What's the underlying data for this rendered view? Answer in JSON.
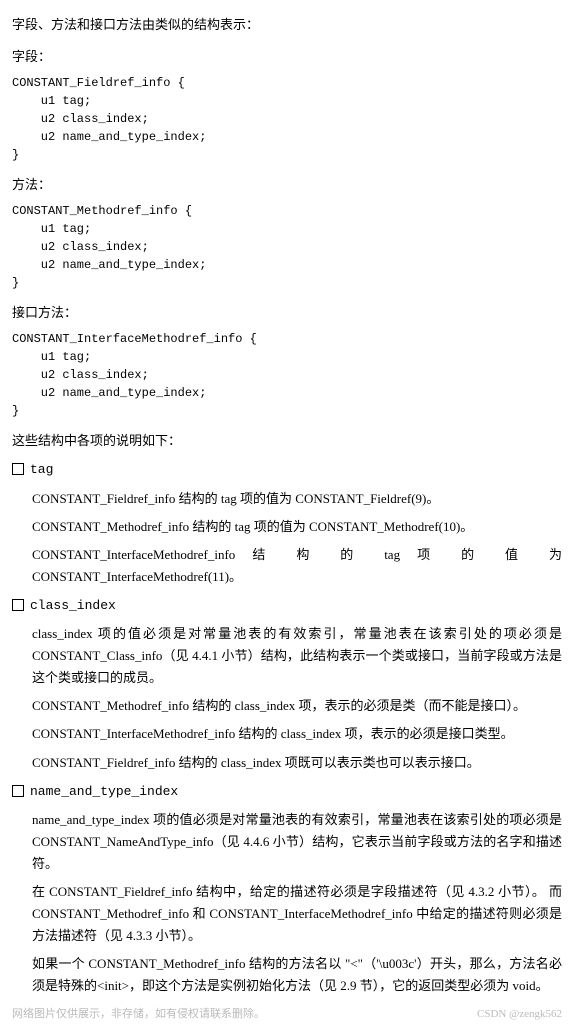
{
  "intro": "字段、方法和接口方法由类似的结构表示：",
  "field_label": "字段：",
  "field_code": "CONSTANT_Fieldref_info {\n    u1 tag;\n    u2 class_index;\n    u2 name_and_type_index;\n}",
  "method_label": "方法：",
  "method_code": "CONSTANT_Methodref_info {\n    u1 tag;\n    u2 class_index;\n    u2 name_and_type_index;\n}",
  "iface_label": "接口方法：",
  "iface_code": "CONSTANT_InterfaceMethodref_info {\n    u1 tag;\n    u2 class_index;\n    u2 name_and_type_index;\n}",
  "explain_intro": "这些结构中各项的说明如下：",
  "bullets": {
    "tag": {
      "label": "tag",
      "p1": "CONSTANT_Fieldref_info 结构的 tag 项的值为 CONSTANT_Fieldref(9)。",
      "p2": "CONSTANT_Methodref_info 结构的 tag 项的值为 CONSTANT_Methodref(10)。",
      "p3": "CONSTANT_InterfaceMethodref_info 结 构 的 tag 项 的 值 为 CONSTANT_InterfaceMethodref(11)。"
    },
    "class_index": {
      "label": "class_index",
      "p1": "class_index 项的值必须是对常量池表的有效索引，常量池表在该索引处的项必须是 CONSTANT_Class_info（见 4.4.1 小节）结构，此结构表示一个类或接口，当前字段或方法是这个类或接口的成员。",
      "p2": "CONSTANT_Methodref_info 结构的 class_index 项，表示的必须是类（而不能是接口）。",
      "p3": "CONSTANT_InterfaceMethodref_info 结构的 class_index 项，表示的必须是接口类型。",
      "p4": "CONSTANT_Fieldref_info 结构的 class_index 项既可以表示类也可以表示接口。"
    },
    "name_and_type_index": {
      "label": "name_and_type_index",
      "p1": "name_and_type_index 项的值必须是对常量池表的有效索引，常量池表在该索引处的项必须是 CONSTANT_NameAndType_info（见 4.4.6 小节）结构，它表示当前字段或方法的名字和描述符。",
      "p2": "在 CONSTANT_Fieldref_info 结构中，给定的描述符必须是字段描述符（见 4.3.2 小节）。 而 CONSTANT_Methodref_info 和 CONSTANT_InterfaceMethodref_info 中给定的描述符则必须是方法描述符（见 4.3.3 小节）。",
      "p3": "如果一个 CONSTANT_Methodref_info 结构的方法名以 \"<\"（'\\u003c'）开头，那么，方法名必须是特殊的<init>，即这个方法是实例初始化方法（见 2.9 节），它的返回类型必须为 void。"
    }
  },
  "footer": {
    "left": "网络图片仅供展示，非存储，如有侵权请联系删除。",
    "right": "CSDN @zengk562"
  }
}
